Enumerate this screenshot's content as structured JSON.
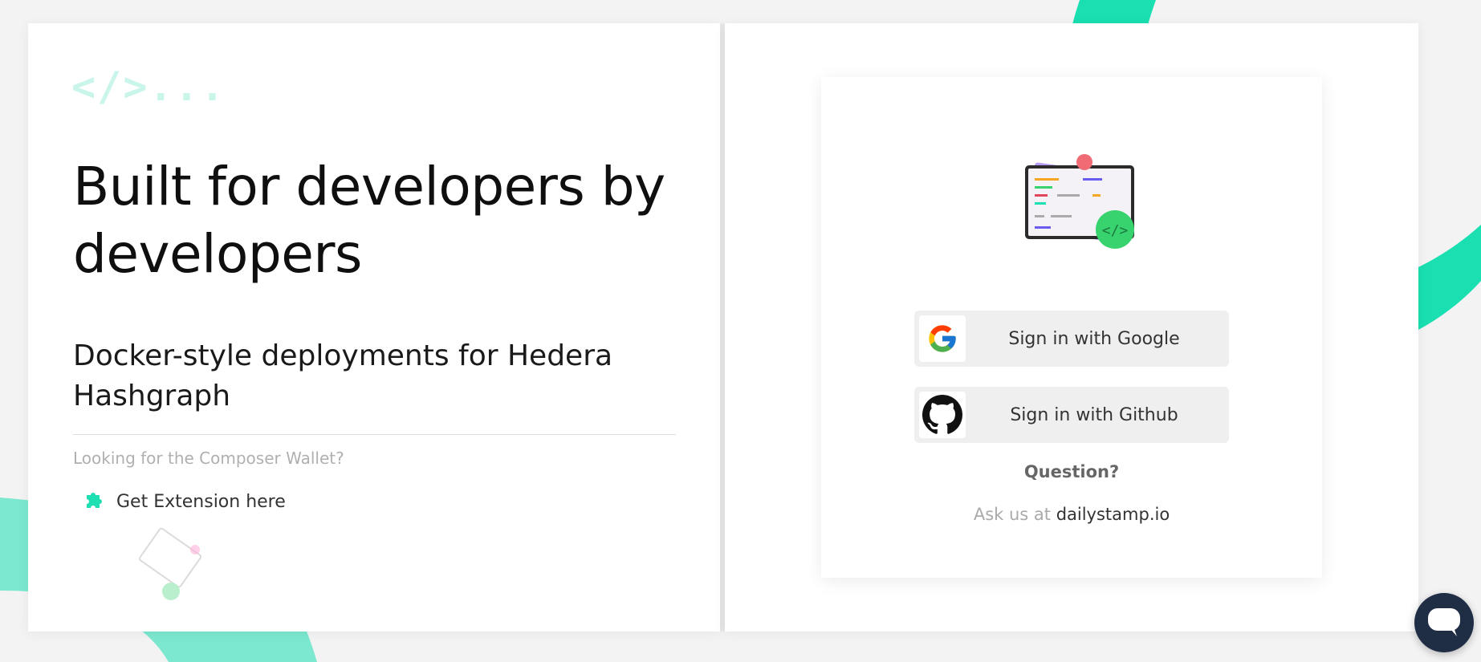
{
  "logo": {
    "text": "</>..."
  },
  "hero": {
    "title": "Built for developers by developers",
    "subtitle": "Docker-style deployments for Hedera Hashgraph"
  },
  "wallet": {
    "question": "Looking for the Composer Wallet?",
    "extension_label": "Get Extension here",
    "extension_icon": "puzzle-piece-icon"
  },
  "signin": {
    "google_label": "Sign in with Google",
    "github_label": "Sign in with Github",
    "question": "Question?",
    "ask_prefix": "Ask us at",
    "ask_link": "dailystamp.io"
  },
  "colors": {
    "accent": "#1de0b2",
    "chat": "#1f2d45"
  }
}
